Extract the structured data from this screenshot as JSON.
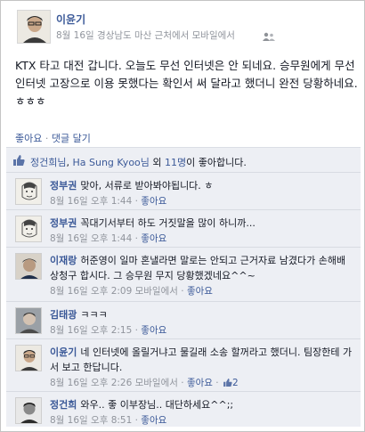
{
  "post": {
    "author": "이윤기",
    "meta": "8월 16일 경상남도 마산 근처에서 모바일에서",
    "body": "KTX 타고 대전 갑니다. 오늘도 무선 인터넷은 안 되네요. 승무원에게 무선 인터넷 고장으로 이용 못했다는 확인서 써 달라고 했더니 완전 당황하네요. ㅎㅎㅎ",
    "like_action": "좋아요",
    "separator": " · ",
    "comment_action": "댓글 달기"
  },
  "likes": {
    "name1": "정건희님",
    "sep": ", ",
    "name2": "Ha Sung Kyoo님",
    "middle": " 외 ",
    "count": "11명",
    "suffix": "이 좋아합니다."
  },
  "comments": [
    {
      "name": "정부권",
      "text": "맞아, 서류로 받아봐야됩니다. ㅎ",
      "meta": "8월 16일 오후 1:44",
      "sep": " · ",
      "like": "좋아요",
      "extra": ""
    },
    {
      "name": "정부권",
      "text": "꼭대기서부터 하도 거짓말을 많이 하니까...",
      "meta": "8월 16일 오후 1:44",
      "sep": " · ",
      "like": "좋아요",
      "extra": ""
    },
    {
      "name": "이재랑",
      "text": "허준영이 일마 혼낼라면 말로는 안되고 근거자료 남겼다가 손해배상청구 합시다. 그 승무원 무지 당황했겠네요^^~",
      "meta": "8월 16일 오후 2:09 모바일에서",
      "sep": " · ",
      "like": "좋아요",
      "extra": ""
    },
    {
      "name": "김태광",
      "text": "ㅋㅋㅋ",
      "meta": "8월 16일 오후 2:15",
      "sep": " · ",
      "like": "좋아요",
      "extra": ""
    },
    {
      "name": "이윤기",
      "text": "네 인터넷에 올릴거냐고 물길래 소송 할꺼라고 했더니. 팀장한테 가서 보고 한답니다.",
      "meta": "8월 16일 오후 2:26 모바일에서",
      "sep": " · ",
      "like": "좋아요",
      "extra": "2"
    },
    {
      "name": "정건희",
      "text": "와우.. 좋 이부장님.. 대단하세요^^;;",
      "meta": "8월 16일 오후 8:51",
      "sep": " · ",
      "like": "좋아요",
      "extra": ""
    }
  ],
  "colors": {
    "link": "#3b5998",
    "meta": "#90949c",
    "feedback_bg": "#edeff4"
  },
  "icons": [
    "people-icon",
    "thumbs-up-icon"
  ]
}
